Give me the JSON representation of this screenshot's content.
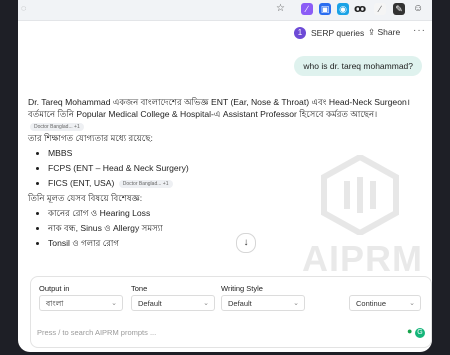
{
  "browser": {
    "edge_glyph": "ꝏ"
  },
  "header": {
    "serp_count": "1",
    "serp_label": "SERP queries",
    "share_label": "Share",
    "more_label": "···"
  },
  "user_message": "who is dr. tareq mohammad?",
  "answer": {
    "intro_line1": "Dr. Tareq Mohammad একজন বাংলাদেশের অভিজ্ঞ ENT (Ear, Nose & Throat) এবং Head-Neck Surgeon।",
    "intro_line2": "বর্তমানে তিনি Popular Medical College & Hospital-এ Assistant Professor হিসেবে কর্মরত আছেন।",
    "intro_cite": "Doctor Banglad...  +1",
    "edu_heading": "তার শিক্ষাগত যোগ্যতার মধ্যে রয়েছে:",
    "edu_items": [
      "MBBS",
      "FCPS (ENT – Head & Neck Surgery)",
      "FICS (ENT, USA)"
    ],
    "edu_cite": "Doctor Banglad...  +1",
    "spec_heading": "তিনি মূলত যেসব বিষয়ে বিশেষজ্ঞ:",
    "spec_items": [
      "কানের রোগ ও Hearing Loss",
      "নাক বন্ধ, Sinus ও Allergy সমস্যা",
      "Tonsil ও গলার রোগ"
    ]
  },
  "watermark": {
    "text": "AIPRM"
  },
  "scroll_down_label": "↓",
  "prompt_panel": {
    "output_label": "Output in",
    "output_value": "বাংলা",
    "tone_label": "Tone",
    "tone_value": "Default",
    "style_label": "Writing Style",
    "style_value": "Default",
    "continue_label": "Continue",
    "search_placeholder": "Press / to search AIPRM prompts ..."
  },
  "colors": {
    "accent": "#6d4ad6",
    "user_bubble": "#dff2ee",
    "background": "#1e1f26"
  }
}
